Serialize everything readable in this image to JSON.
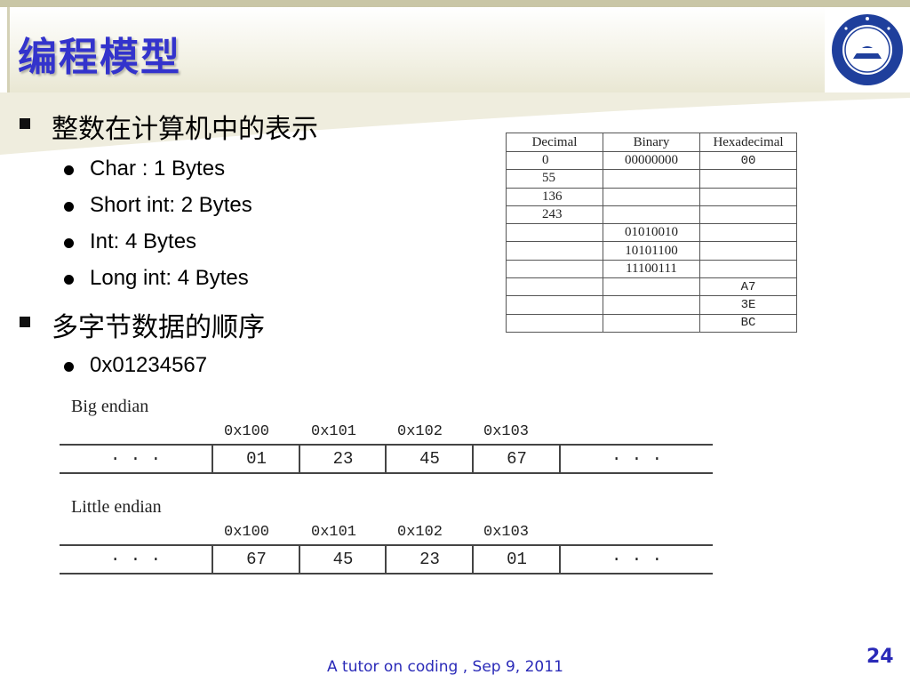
{
  "slide": {
    "title": "编程模型",
    "footer": "A tutor on coding , Sep 9, 2011",
    "page_number": "24"
  },
  "bullets": {
    "section1": "整数在计算机中的表示",
    "items1": [
      "Char : 1 Bytes",
      "Short int: 2 Bytes",
      "Int: 4 Bytes",
      "Long int: 4 Bytes"
    ],
    "section2": "多字节数据的顺序",
    "items2": [
      "0x01234567"
    ]
  },
  "conversion_table": {
    "headers": [
      "Decimal",
      "Binary",
      "Hexadecimal"
    ],
    "rows": [
      [
        "0",
        "00000000",
        "00"
      ],
      [
        "55",
        "",
        ""
      ],
      [
        "136",
        "",
        ""
      ],
      [
        "243",
        "",
        ""
      ],
      [
        "",
        "01010010",
        ""
      ],
      [
        "",
        "10101100",
        ""
      ],
      [
        "",
        "11100111",
        ""
      ],
      [
        "",
        "",
        "A7"
      ],
      [
        "",
        "",
        "3E"
      ],
      [
        "",
        "",
        "BC"
      ]
    ]
  },
  "big_endian": {
    "label": "Big endian",
    "addresses": [
      "0x100",
      "0x101",
      "0x102",
      "0x103"
    ],
    "cells": [
      "· · ·",
      "01",
      "23",
      "45",
      "67",
      "· · ·"
    ]
  },
  "little_endian": {
    "label": "Little endian",
    "addresses": [
      "0x100",
      "0x101",
      "0x102",
      "0x103"
    ],
    "cells": [
      "· · ·",
      "67",
      "45",
      "23",
      "01",
      "· · ·"
    ]
  },
  "colors": {
    "title": "#3333cc",
    "footer": "#2a2ab8"
  }
}
